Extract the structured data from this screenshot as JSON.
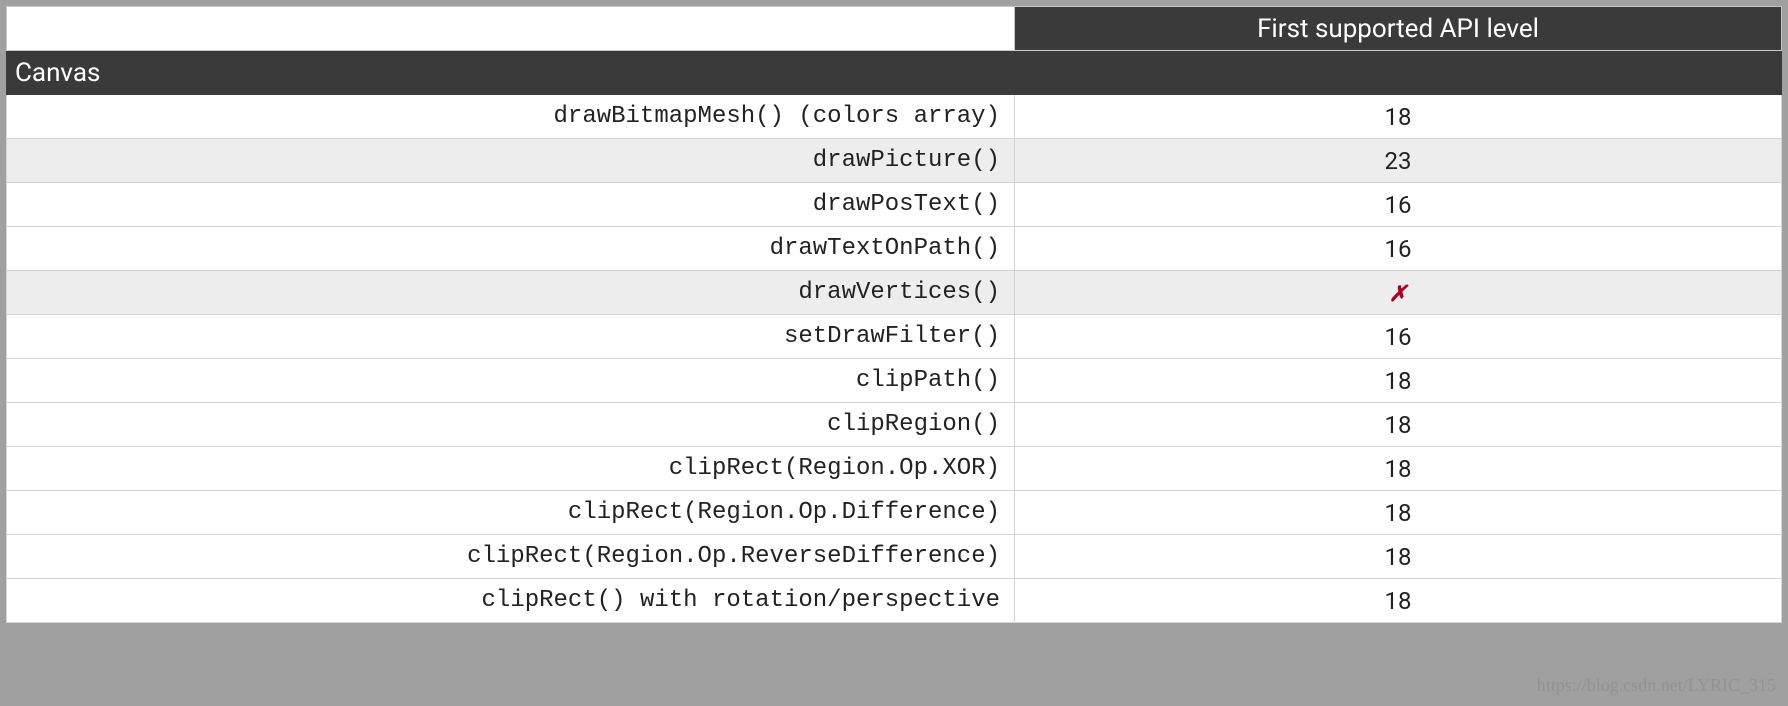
{
  "header": {
    "col1": "",
    "col2": "First supported API level"
  },
  "section": {
    "title": "Canvas"
  },
  "rows": [
    {
      "method": "drawBitmapMesh() (colors array)",
      "api": "18",
      "alt": false,
      "unsupported": false
    },
    {
      "method": "drawPicture()",
      "api": "23",
      "alt": true,
      "unsupported": false
    },
    {
      "method": "drawPosText()",
      "api": "16",
      "alt": false,
      "unsupported": false
    },
    {
      "method": "drawTextOnPath()",
      "api": "16",
      "alt": false,
      "unsupported": false
    },
    {
      "method": "drawVertices()",
      "api": "✗",
      "alt": true,
      "unsupported": true
    },
    {
      "method": "setDrawFilter()",
      "api": "16",
      "alt": false,
      "unsupported": false
    },
    {
      "method": "clipPath()",
      "api": "18",
      "alt": false,
      "unsupported": false
    },
    {
      "method": "clipRegion()",
      "api": "18",
      "alt": false,
      "unsupported": false
    },
    {
      "method": "clipRect(Region.Op.XOR)",
      "api": "18",
      "alt": false,
      "unsupported": false
    },
    {
      "method": "clipRect(Region.Op.Difference)",
      "api": "18",
      "alt": false,
      "unsupported": false
    },
    {
      "method": "clipRect(Region.Op.ReverseDifference)",
      "api": "18",
      "alt": false,
      "unsupported": false
    },
    {
      "method": "clipRect() with rotation/perspective",
      "api": "18",
      "alt": false,
      "unsupported": false
    }
  ],
  "watermark": "https://blog.csdn.net/LYRIC_315"
}
